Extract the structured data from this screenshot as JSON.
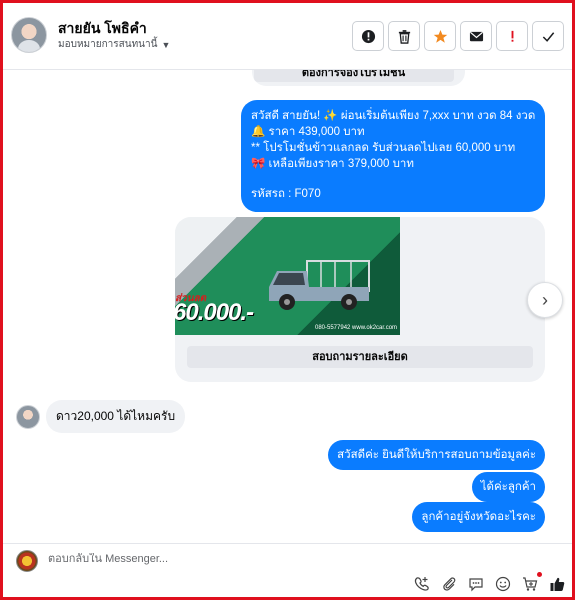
{
  "header": {
    "contact_name": "สายยัน โพธิคำ",
    "assignee_label": "มอบหมายการสนทนานี้"
  },
  "thread": {
    "cut_off_button": "ต้องการจองโปรโมชั่น",
    "promo_message": {
      "line1": "สวัสดี สายยัน! ✨  ผ่อนเริ่มต้นเพียง 7,xxx บาท งวด 84 งวด",
      "line2": "🔔 ราคา 439,000 บาท",
      "line3": "** โปรโมชั่นข้าวแลกลด รับส่วนลดไปเลย 60,000 บาท",
      "line4": "🎀  เหลือเพียงราคา 379,000 บาท",
      "line5": "รหัสรถ : F070"
    },
    "card": {
      "ad_label": "ส่วนลด",
      "ad_price": "60.000.-",
      "phone_tag": "080-5577942 www.ok2car.com",
      "detail_button": "สอบถามรายละเอียด"
    },
    "incoming_message": "ดาว20,000 ได้ไหมครับ",
    "outgoing": [
      "สวัสดีค่ะ  ยินดีให้บริการสอบถามข้อมูลค่ะ",
      "ได้ค่ะลูกค้า",
      "ลูกค้าอยู่จังหวัดอะไรคะ"
    ]
  },
  "composer": {
    "placeholder": "ตอบกลับใน Messenger..."
  },
  "colors": {
    "accent_blue": "#0a7cff",
    "frame_red": "#e0101e",
    "star_orange": "#f28a20"
  },
  "icons": [
    "info-icon",
    "trash-icon",
    "star-icon",
    "envelope-icon",
    "exclamation-icon",
    "check-icon",
    "chevron-right-icon",
    "add-contact-icon",
    "attach-icon",
    "saved-reply-icon",
    "emoji-icon",
    "cart-icon",
    "like-icon"
  ]
}
